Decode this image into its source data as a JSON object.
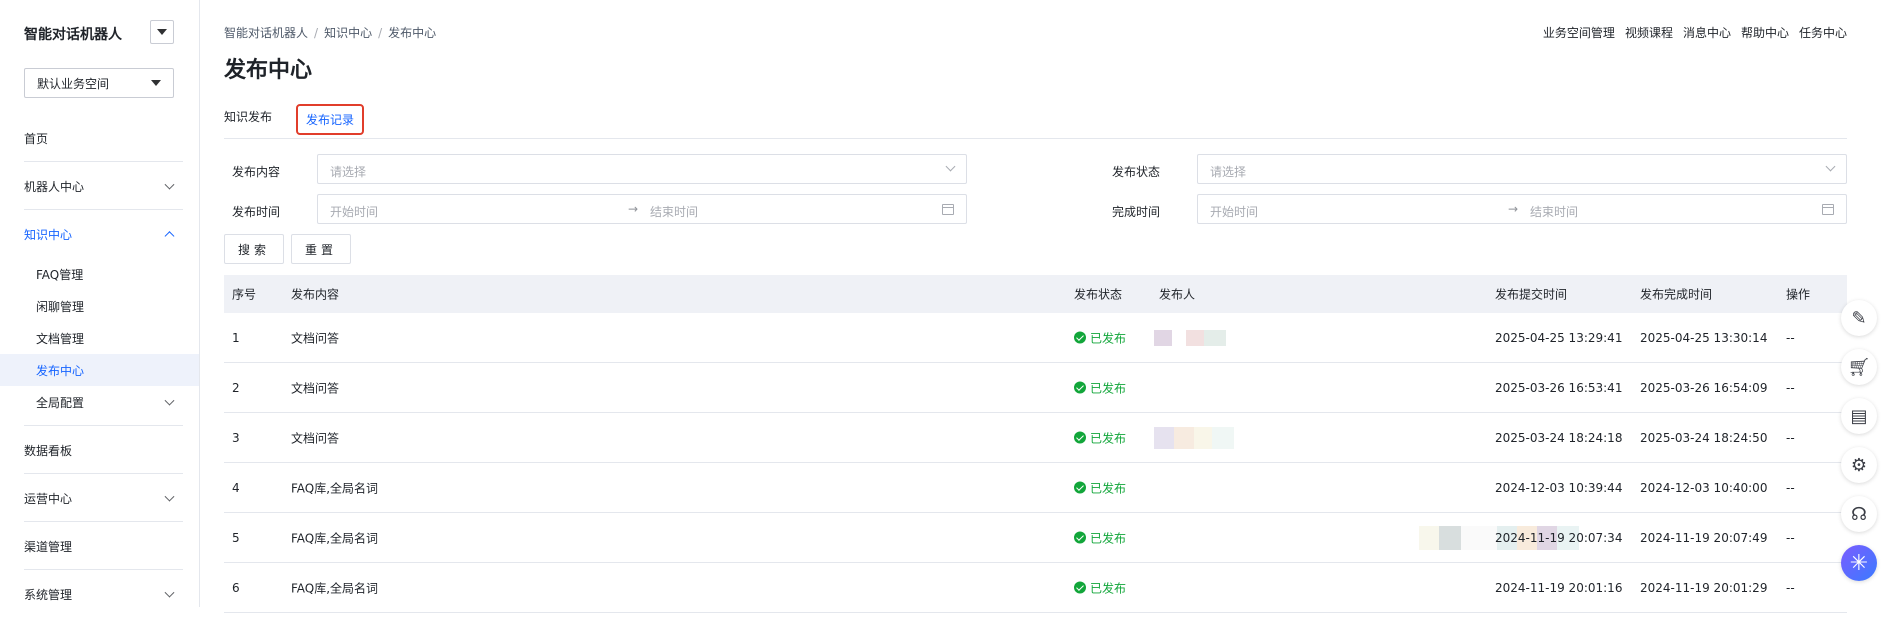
{
  "sidebar": {
    "brand": "智能对话机器人",
    "workspace": "默认业务空间",
    "nav": {
      "home": "首页",
      "robot": "机器人中心",
      "knowledge": "知识中心",
      "knowledge_children": [
        "FAQ管理",
        "闲聊管理",
        "文档管理",
        "发布中心",
        "全局配置"
      ],
      "dashboard": "数据看板",
      "operations": "运营中心",
      "channels": "渠道管理",
      "system": "系统管理"
    }
  },
  "header": {
    "breadcrumb": [
      "智能对话机器人",
      "知识中心",
      "发布中心"
    ],
    "links": [
      "业务空间管理",
      "视频课程",
      "消息中心",
      "帮助中心",
      "任务中心"
    ]
  },
  "page": {
    "title": "发布中心",
    "tabs": [
      "知识发布",
      "发布记录"
    ],
    "active_tab": "发布记录"
  },
  "filters": {
    "content_label": "发布内容",
    "content_placeholder": "请选择",
    "status_label": "发布状态",
    "status_placeholder": "请选择",
    "publish_time_label": "发布时间",
    "finish_time_label": "完成时间",
    "start_placeholder": "开始时间",
    "end_placeholder": "结束时间",
    "arrow": "→",
    "search_button": "搜索",
    "reset_button": "重置"
  },
  "table": {
    "columns": [
      "序号",
      "发布内容",
      "发布状态",
      "发布人",
      "发布提交时间",
      "发布完成时间",
      "操作"
    ],
    "rows": [
      {
        "index": "1",
        "content": "文档问答",
        "status": "已发布",
        "submitted": "2025-04-25 13:29:41",
        "completed": "2025-04-25 13:30:14",
        "action": "--"
      },
      {
        "index": "2",
        "content": "文档问答",
        "status": "已发布",
        "submitted": "2025-03-26 16:53:41",
        "completed": "2025-03-26 16:54:09",
        "action": "--"
      },
      {
        "index": "3",
        "content": "文档问答",
        "status": "已发布",
        "submitted": "2025-03-24 18:24:18",
        "completed": "2025-03-24 18:24:50",
        "action": "--"
      },
      {
        "index": "4",
        "content": "FAQ库,全局名词",
        "status": "已发布",
        "submitted": "2024-12-03 10:39:44",
        "completed": "2024-12-03 10:40:00",
        "action": "--"
      },
      {
        "index": "5",
        "content": "FAQ库,全局名词",
        "status": "已发布",
        "submitted": "2024-11-19 20:07:34",
        "completed": "2024-11-19 20:07:49",
        "action": "--"
      },
      {
        "index": "6",
        "content": "FAQ库,全局名词",
        "status": "已发布",
        "submitted": "2024-11-19 20:01:16",
        "completed": "2024-11-19 20:01:29",
        "action": "--"
      }
    ]
  },
  "colors": {
    "accent": "#1664ff",
    "success": "#12a63a",
    "highlight_border": "#e13d2b",
    "table_header_bg": "#eff1f6"
  },
  "float_toolbar": [
    "edit-icon",
    "cart-icon",
    "contract-icon",
    "gear-icon",
    "headset-icon",
    "assistant-logo-icon"
  ]
}
